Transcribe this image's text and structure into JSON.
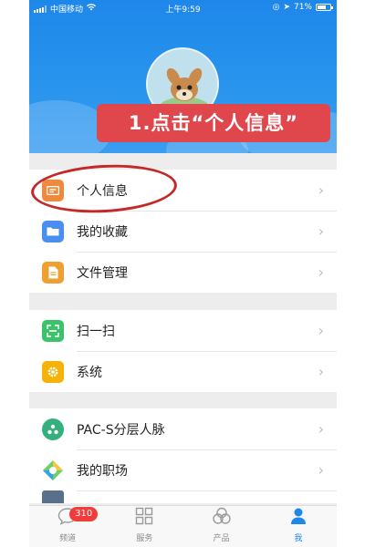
{
  "status_bar": {
    "carrier": "中国移动",
    "time": "上午9:59",
    "battery": "71%"
  },
  "header": {
    "annotation": "1.点击“个人信息”"
  },
  "groups": [
    {
      "items": [
        {
          "label": "个人信息",
          "icon": "profile-card-icon",
          "color": "#ef8a3c"
        },
        {
          "label": "我的收藏",
          "icon": "folder-icon",
          "color": "#4a8ff0"
        },
        {
          "label": "文件管理",
          "icon": "document-icon",
          "color": "#f0a030"
        }
      ]
    },
    {
      "items": [
        {
          "label": "扫一扫",
          "icon": "scan-icon",
          "color": "#3cc36a"
        },
        {
          "label": "系统",
          "icon": "gear-icon",
          "color": "#f5b30a"
        }
      ]
    },
    {
      "items": [
        {
          "label": "PAC-S分层人脉",
          "icon": "network-icon",
          "color": "#35b07c"
        },
        {
          "label": "我的职场",
          "icon": "workplace-icon",
          "color": "#6ccf6a"
        }
      ]
    }
  ],
  "tabbar": {
    "tabs": [
      {
        "label": "频道",
        "icon": "chat-bubble-icon",
        "badge": "310"
      },
      {
        "label": "服务",
        "icon": "grid-icon"
      },
      {
        "label": "产品",
        "icon": "circles-icon"
      },
      {
        "label": "我",
        "icon": "person-icon",
        "active": true
      }
    ]
  },
  "colors": {
    "header_blue": "#1e87ea",
    "annotation_red": "#e0474c",
    "badge_red": "#f23c3c"
  }
}
